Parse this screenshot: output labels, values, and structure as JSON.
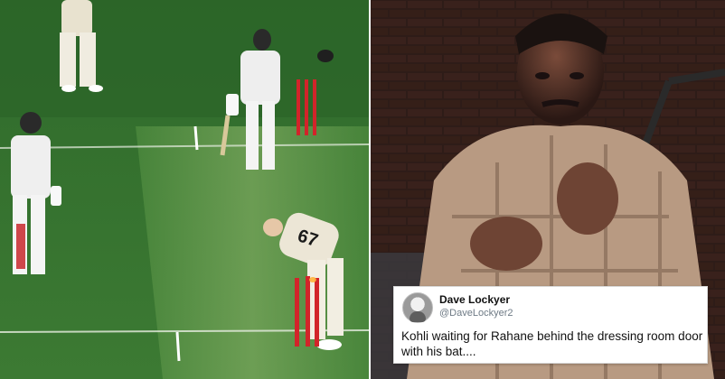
{
  "photos": {
    "left": {
      "description_icon": "cricket-field-photo",
      "jersey_number": "67",
      "colors": {
        "pitch": "#3f7f34",
        "grass_dark": "#356e2c",
        "stumps": "#d2242a"
      }
    },
    "right": {
      "description_icon": "movie-still-photo",
      "colors": {
        "wall": "#3a2420",
        "shirt": "#b89a82"
      }
    }
  },
  "tweet": {
    "name": "Dave Lockyer",
    "handle": "@DaveLockyer2",
    "text": "Kohli waiting for Rahane behind the dressing room door with his bat....",
    "avatar_icon": "profile-avatar"
  }
}
